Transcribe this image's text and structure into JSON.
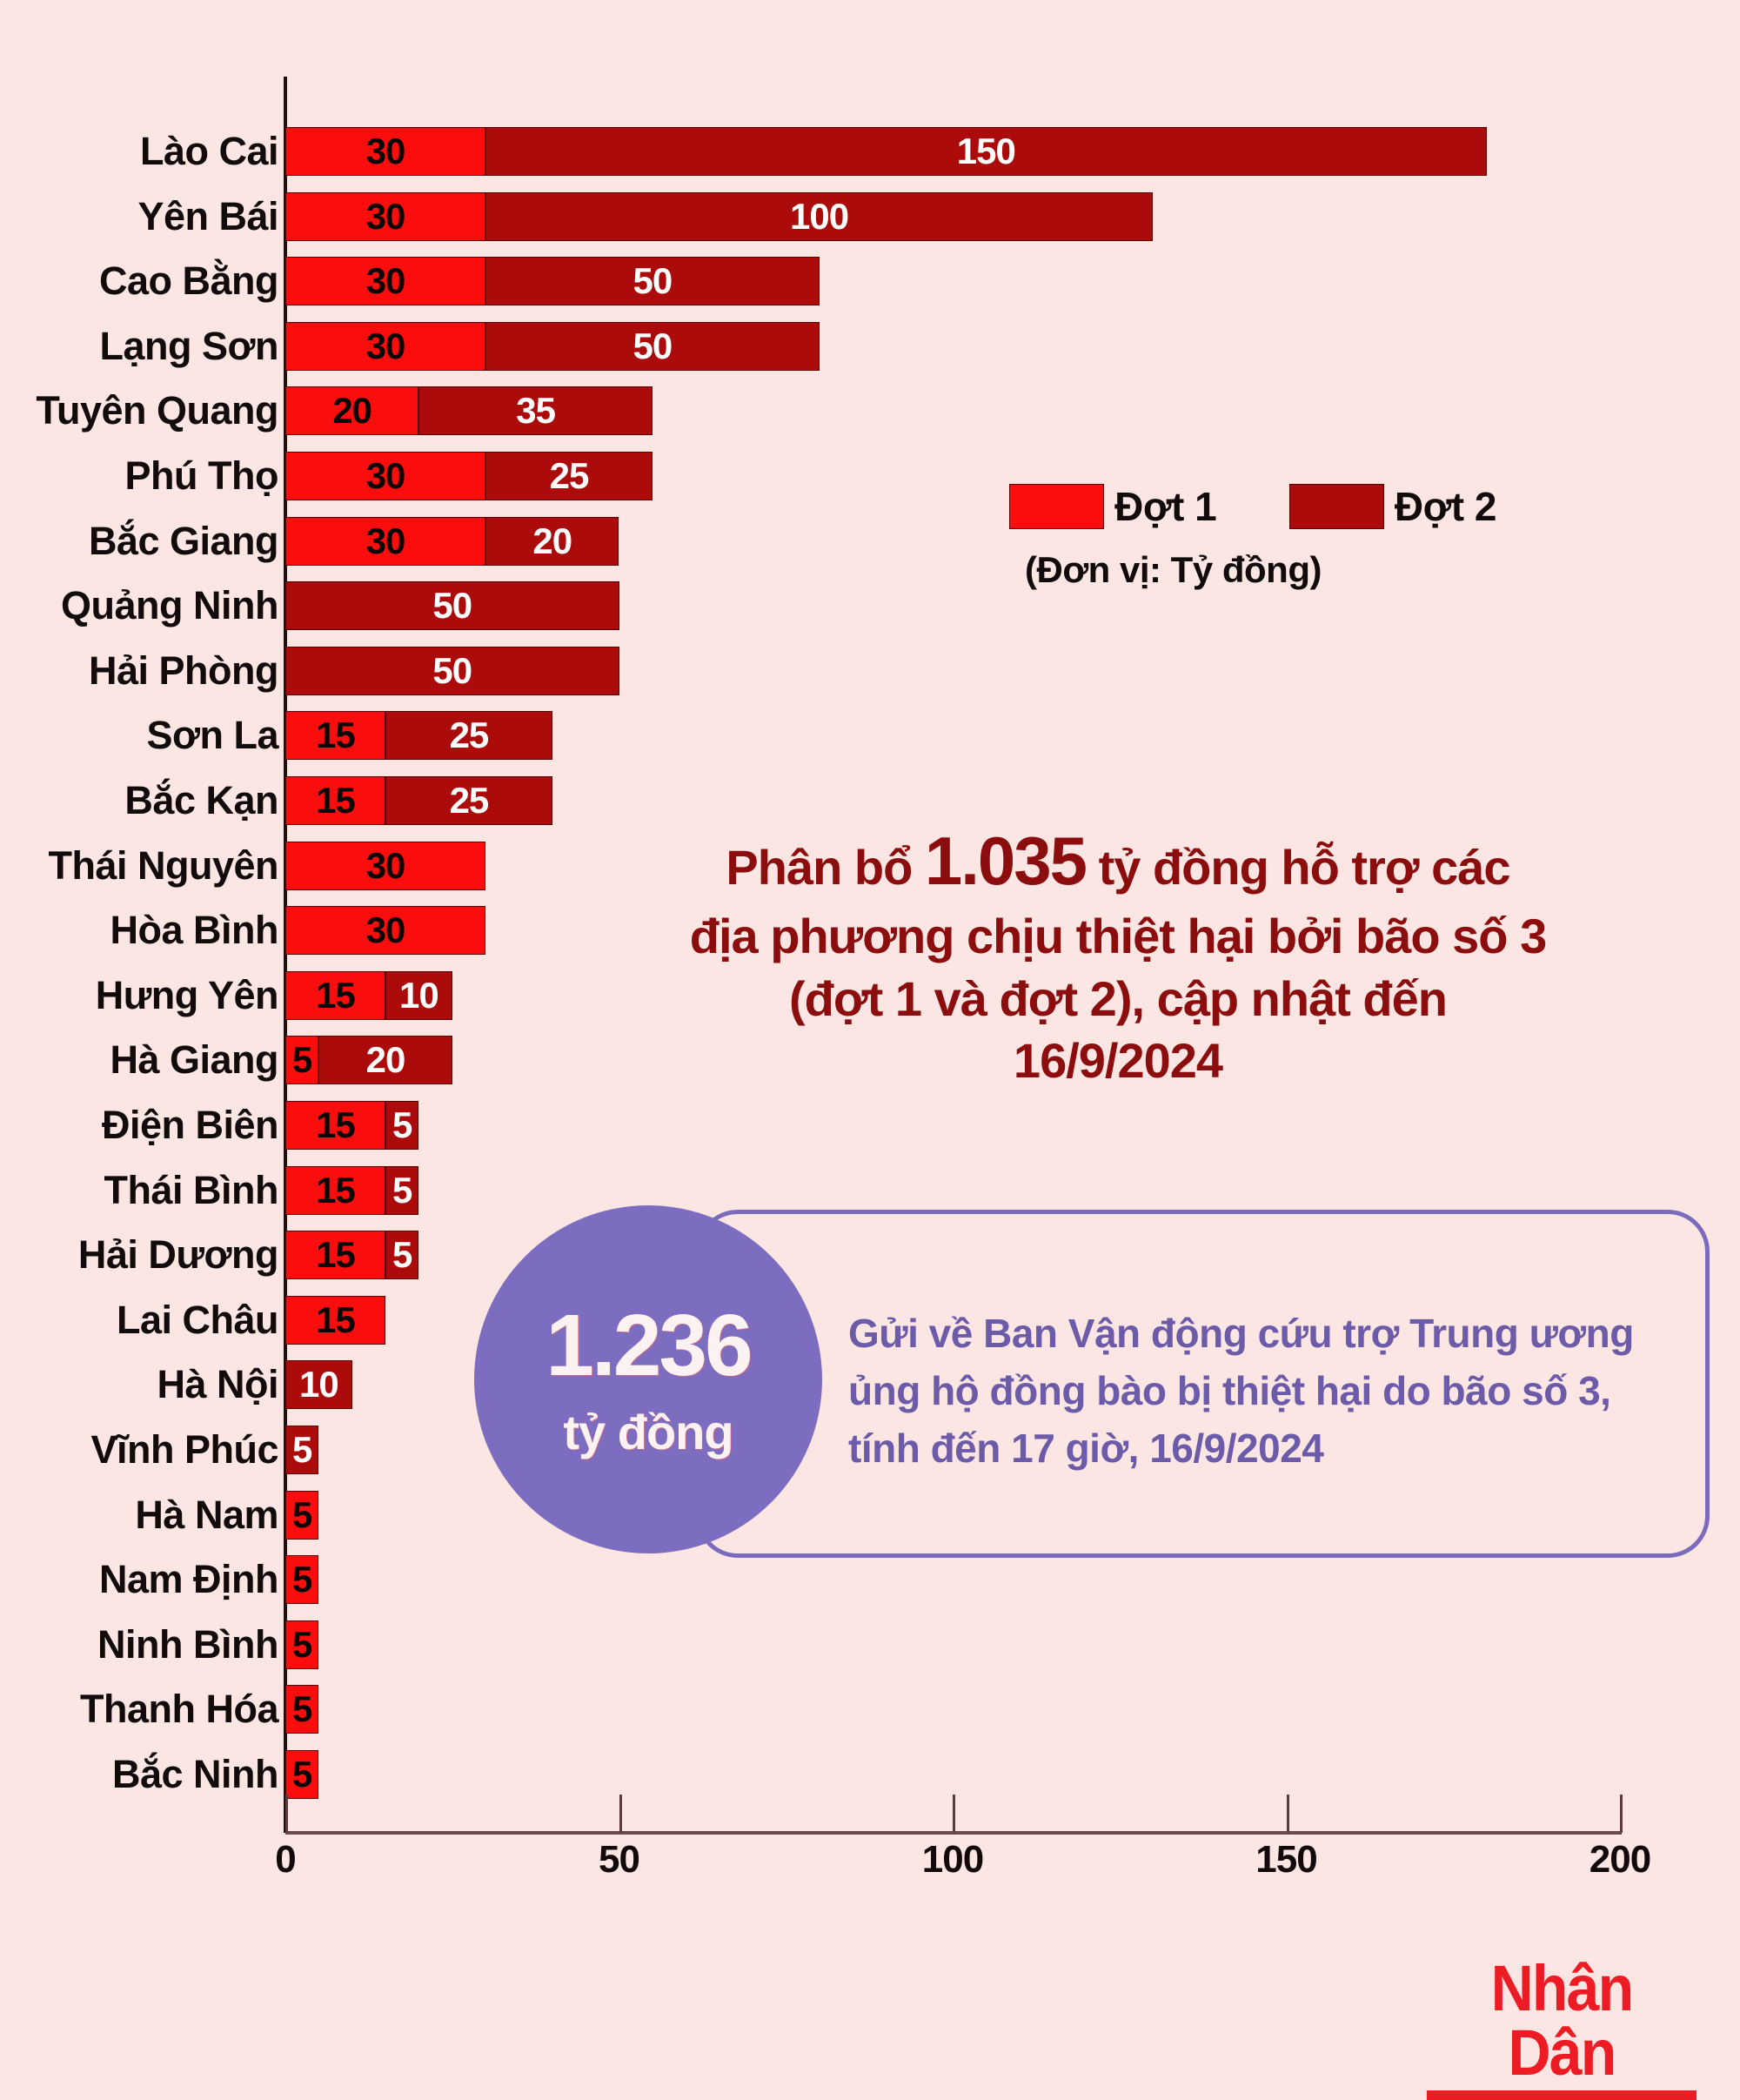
{
  "background_color": "#fce6e4",
  "title": {
    "line1_pre": "Phân bổ ",
    "line1_big": "1.035",
    "line1_post": " tỷ đồng hỗ trợ các",
    "line2": "địa phương chịu thiệt hại bởi bão số 3",
    "line3": "(đợt 1 và đợt 2), cập nhật đến",
    "line4": "16/9/2024",
    "color": "#8c0d0d"
  },
  "legend": {
    "series1_label": "Đợt 1",
    "series2_label": "Đợt 2",
    "series1_color": "#fb0d0d",
    "series2_color": "#ab0b0b",
    "unit_note": "(Đơn vị: Tỷ đồng)"
  },
  "callout": {
    "amount": "1.236",
    "amount_unit": "tỷ đồng",
    "circle_color": "#7c6dc0",
    "border_color": "#7b6bbd",
    "text_color": "#6b5ba8",
    "line1": "Gửi về Ban Vận động cứu trợ Trung ương",
    "line2": "ủng hộ đồng bào bị thiệt hại do bão số 3,",
    "line3": "tính đến 17 giờ, 16/9/2024"
  },
  "logo": {
    "text": "Nhân Dân",
    "color": "#ed1c24"
  },
  "chart_data": {
    "type": "bar",
    "orientation": "horizontal",
    "stacked": true,
    "title": "Phân bổ 1.035 tỷ đồng hỗ trợ các địa phương chịu thiệt hại bởi bão số 3 (đợt 1 và đợt 2), cập nhật đến 16/9/2024",
    "xlabel": "",
    "ylabel": "",
    "unit": "Tỷ đồng",
    "xlim": [
      0,
      200
    ],
    "xticks": [
      0,
      50,
      100,
      150,
      200
    ],
    "xtick_labels": [
      "0",
      "50",
      "100",
      "150",
      "200"
    ],
    "grid": false,
    "legend_position": "middle-right",
    "categories": [
      "Lào Cai",
      "Yên Bái",
      "Cao Bằng",
      "Lạng Sơn",
      "Tuyên Quang",
      "Phú Thọ",
      "Bắc Giang",
      "Quảng Ninh",
      "Hải Phòng",
      "Sơn La",
      "Bắc Kạn",
      "Thái Nguyên",
      "Hòa Bình",
      "Hưng Yên",
      "Hà Giang",
      "Điện Biên",
      "Thái Bình",
      "Hải Dương",
      "Lai Châu",
      "Hà Nội",
      "Vĩnh Phúc",
      "Hà Nam",
      "Nam Định",
      "Ninh Bình",
      "Thanh Hóa",
      "Bắc Ninh"
    ],
    "series": [
      {
        "name": "Đợt 1",
        "color": "#fb0d0d",
        "values": [
          30,
          30,
          30,
          30,
          20,
          30,
          30,
          0,
          0,
          15,
          15,
          30,
          30,
          15,
          5,
          15,
          15,
          15,
          15,
          0,
          0,
          5,
          5,
          5,
          5,
          5
        ]
      },
      {
        "name": "Đợt 2",
        "color": "#ab0b0b",
        "values": [
          150,
          100,
          50,
          50,
          35,
          25,
          20,
          50,
          50,
          25,
          25,
          0,
          0,
          10,
          20,
          5,
          5,
          5,
          0,
          10,
          5,
          0,
          0,
          0,
          0,
          0
        ]
      }
    ],
    "totals": [
      180,
      130,
      80,
      80,
      55,
      55,
      50,
      50,
      50,
      40,
      40,
      30,
      30,
      25,
      25,
      20,
      20,
      20,
      15,
      10,
      5,
      5,
      5,
      5,
      5,
      5
    ],
    "grand_total": 1035
  }
}
